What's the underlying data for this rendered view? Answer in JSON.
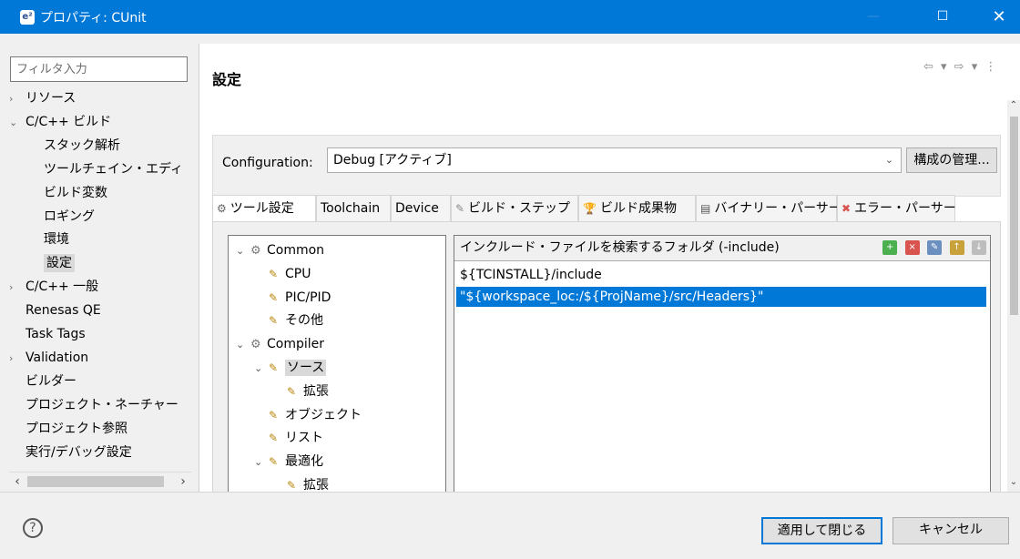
{
  "window": {
    "title": "プロパティ: CUnit",
    "app_icon": "e²",
    "minimize_label": "—",
    "maximize_label": "☐",
    "close_label": "✕"
  },
  "filter": {
    "placeholder": "フィルタ入力"
  },
  "nav_tree": [
    {
      "label": "リソース",
      "arrow": "›",
      "selected": false
    },
    {
      "label": "C/C++ ビルド",
      "arrow": "⌄",
      "selected": false
    },
    {
      "label": "スタック解析",
      "arrow": "",
      "selected": false
    },
    {
      "label": "ツールチェイン・エディ",
      "arrow": "",
      "selected": false
    },
    {
      "label": "ビルド変数",
      "arrow": "",
      "selected": false
    },
    {
      "label": "ロギング",
      "arrow": "",
      "selected": false
    },
    {
      "label": "環境",
      "arrow": "",
      "selected": false
    },
    {
      "label": "設定",
      "arrow": "",
      "selected": true
    },
    {
      "label": "C/C++ 一般",
      "arrow": "›",
      "selected": false
    },
    {
      "label": "Renesas QE",
      "arrow": "",
      "selected": false
    },
    {
      "label": "Task Tags",
      "arrow": "",
      "selected": false
    },
    {
      "label": "Validation",
      "arrow": "›",
      "selected": false
    },
    {
      "label": "ビルダー",
      "arrow": "",
      "selected": false
    },
    {
      "label": "プロジェクト・ネーチャー",
      "arrow": "",
      "selected": false
    },
    {
      "label": "プロジェクト参照",
      "arrow": "",
      "selected": false
    },
    {
      "label": "実行/デバッグ設定",
      "arrow": "",
      "selected": false
    }
  ],
  "page": {
    "title": "設定",
    "nav_arrows": "⇦ ▾ ⇨ ▾ ⋮"
  },
  "configuration": {
    "label": "Configuration:",
    "value": "Debug [アクティブ]",
    "manage_button": "構成の管理..."
  },
  "tabs": [
    {
      "label": "ツール設定",
      "icon": "⚙",
      "active": true
    },
    {
      "label": "Toolchain",
      "icon": "",
      "active": false
    },
    {
      "label": "Device",
      "icon": "",
      "active": false
    },
    {
      "label": "ビルド・ステップ",
      "icon": "✎",
      "active": false
    },
    {
      "label": "ビルド成果物",
      "icon": "🏆",
      "active": false
    },
    {
      "label": "バイナリー・パーサー",
      "icon": "▤",
      "active": false
    },
    {
      "label": "エラー・パーサー",
      "icon": "✖",
      "active": false
    }
  ],
  "tool_tree": [
    {
      "label": "Common",
      "arrow": "⌄",
      "type": "gear",
      "level": 0,
      "selected": false
    },
    {
      "label": "CPU",
      "arrow": "",
      "type": "tool",
      "level": 1,
      "selected": false
    },
    {
      "label": "PIC/PID",
      "arrow": "",
      "type": "tool",
      "level": 1,
      "selected": false
    },
    {
      "label": "その他",
      "arrow": "",
      "type": "tool",
      "level": 1,
      "selected": false
    },
    {
      "label": "Compiler",
      "arrow": "⌄",
      "type": "gear",
      "level": 0,
      "selected": false
    },
    {
      "label": "ソース",
      "arrow": "⌄",
      "type": "tool",
      "level": 1,
      "selected": true
    },
    {
      "label": "拡張",
      "arrow": "",
      "type": "tool",
      "level": 2,
      "selected": false
    },
    {
      "label": "オブジェクト",
      "arrow": "",
      "type": "tool",
      "level": 1,
      "selected": false
    },
    {
      "label": "リスト",
      "arrow": "",
      "type": "tool",
      "level": 1,
      "selected": false
    },
    {
      "label": "最適化",
      "arrow": "⌄",
      "type": "tool",
      "level": 1,
      "selected": false
    },
    {
      "label": "拡張",
      "arrow": "",
      "type": "tool",
      "level": 2,
      "selected": false
    }
  ],
  "include": {
    "header": "インクルード・ファイルを検索するフォルダ (-include)",
    "rows": [
      {
        "text": "${TCINSTALL}/include",
        "selected": false
      },
      {
        "text": "\"${workspace_loc:/${ProjName}/src/Headers}\"",
        "selected": true
      }
    ]
  },
  "bottom": {
    "help_icon": "?",
    "apply_close": "適用して閉じる",
    "cancel": "キャンセル"
  }
}
